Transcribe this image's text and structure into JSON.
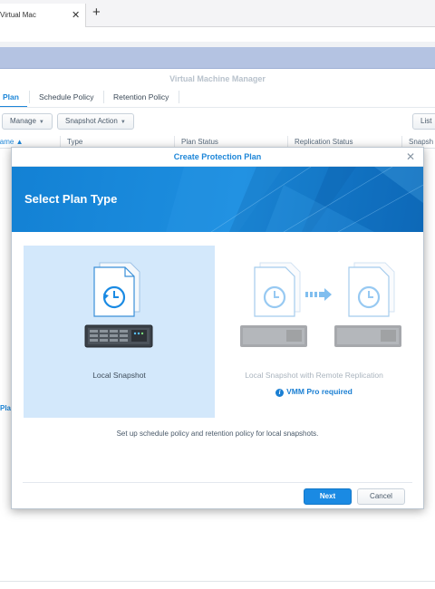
{
  "browser": {
    "tab_title": "Virtual Machine Manager - M",
    "close_glyph": "✕",
    "new_tab_glyph": "+"
  },
  "app": {
    "title": "Virtual Machine Manager",
    "tabs": [
      {
        "label": "Plan",
        "active": true
      },
      {
        "label": "Schedule Policy",
        "active": false
      },
      {
        "label": "Retention Policy",
        "active": false
      }
    ],
    "toolbar": {
      "manage_label": "Manage",
      "snapshot_action_label": "Snapshot Action",
      "list_label": "List",
      "caret": "▼"
    },
    "columns": [
      {
        "label": "Name ▲",
        "active": true
      },
      {
        "label": "Type",
        "active": false
      },
      {
        "label": "Plan Status",
        "active": false
      },
      {
        "label": "Replication Status",
        "active": false
      },
      {
        "label": "Snapsh",
        "active": false
      }
    ],
    "left_link": "Plan"
  },
  "modal": {
    "title": "Create Protection Plan",
    "close_glyph": "✕",
    "banner_title": "Select Plan Type",
    "options": {
      "local": {
        "label": "Local Snapshot",
        "selected": true
      },
      "remote": {
        "label": "Local Snapshot with Remote Replication",
        "selected": false,
        "note": "VMM Pro required",
        "note_icon": "info-icon"
      }
    },
    "description": "Set up schedule policy and retention policy for local snapshots.",
    "next_label": "Next",
    "cancel_label": "Cancel"
  },
  "colors": {
    "accent": "#1d86d8",
    "selected_option_bg": "#d3e8fb",
    "banner_blue": "#1381d4",
    "dsm_header": "#b4c3e2"
  }
}
